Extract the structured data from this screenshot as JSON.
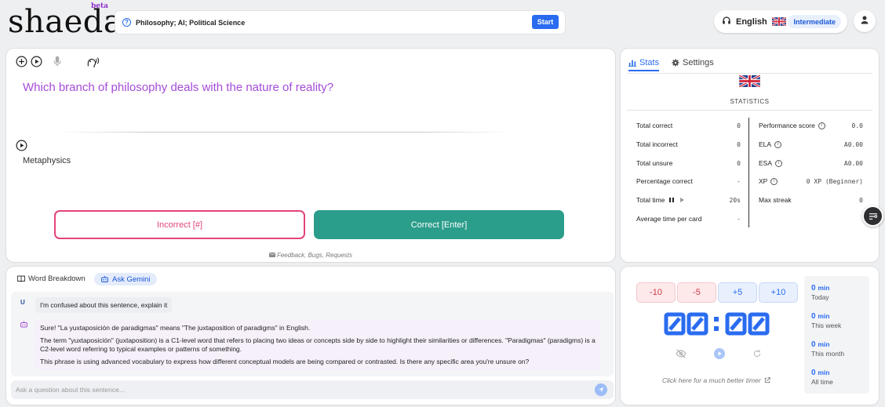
{
  "brand": {
    "logo": "shaeda",
    "beta": "beta"
  },
  "topic_bar": {
    "topics": "Philosophy; AI; Political Science",
    "start_label": "Start"
  },
  "language": {
    "name": "English",
    "level": "Intermediate"
  },
  "flashcard": {
    "question": "Which branch of philosophy deals with the nature of reality?",
    "answer": "Metaphysics",
    "incorrect_label": "Incorrect [#]",
    "correct_label": "Correct [Enter]",
    "feedback_label": "Feedback, Bugs, Requests"
  },
  "stats_panel": {
    "tabs": {
      "stats": "Stats",
      "settings": "Settings"
    },
    "title": "STATISTICS",
    "left": [
      {
        "label": "Total correct",
        "value": "0"
      },
      {
        "label": "Total incorrect",
        "value": "0"
      },
      {
        "label": "Total unsure",
        "value": "0"
      },
      {
        "label": "Percentage correct",
        "value": "-"
      },
      {
        "label": "Total time",
        "value": "20s"
      },
      {
        "label": "Average time per card",
        "value": "-"
      }
    ],
    "right": [
      {
        "label": "Performance score",
        "value": "0.0"
      },
      {
        "label": "ELA",
        "value": "A0.00"
      },
      {
        "label": "ESA",
        "value": "A0.00"
      },
      {
        "label": "XP",
        "value": "0 XP (Beginner)"
      },
      {
        "label": "Max streak",
        "value": "0"
      }
    ]
  },
  "chat": {
    "tabs": {
      "breakdown": "Word Breakdown",
      "gemini": "Ask Gemini"
    },
    "user_badge": "U",
    "user_message": "I'm confused about this sentence, explain it",
    "bot_paragraphs": [
      "Sure! \"La yuxtaposición de paradigmas\" means \"The juxtaposition of paradigms\" in English.",
      "The term \"yuxtaposición\" (juxtaposition) is a C1-level word that refers to placing two ideas or concepts side by side to highlight their similarities or differences. \"Paradigmas\" (paradigms) is a C2-level word referring to typical examples or patterns of something.",
      "This phrase is using advanced vocabulary to express how different conceptual models are being compared or contrasted. Is there any specific area you're unsure on?"
    ],
    "input_placeholder": "Ask a question about this sentence..."
  },
  "timer": {
    "buttons": [
      "-10",
      "-5",
      "+5",
      "+10"
    ],
    "display": "00:00",
    "link": "Click here for a much better timer",
    "totals": [
      {
        "value": "0",
        "unit": "min",
        "label": "Today"
      },
      {
        "value": "0",
        "unit": "min",
        "label": "This week"
      },
      {
        "value": "0",
        "unit": "min",
        "label": "This month"
      },
      {
        "value": "0",
        "unit": "min",
        "label": "All time"
      }
    ]
  },
  "colors": {
    "accent": "#2a6cf0",
    "question": "#a54bd8",
    "incorrect": "#e3447a",
    "correct": "#2b9d8b"
  }
}
